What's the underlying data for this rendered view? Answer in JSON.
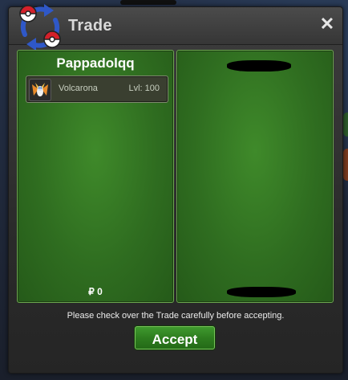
{
  "window": {
    "title": "Trade",
    "close_label": "✕",
    "notice": "Please check over the Trade carefully before accepting.",
    "accept_label": "Accept"
  },
  "left_panel": {
    "player_name": "Pappadolqq",
    "offer": [
      {
        "pokemon": "Volcarona",
        "level": "Lvl: 100",
        "icon": "volcarona-icon"
      }
    ],
    "money": "₽ 0"
  },
  "right_panel": {
    "player_name": "",
    "offer": [],
    "money": ""
  },
  "colors": {
    "panel_green": "#2f6d20",
    "panel_border": "#6ba64e",
    "accept_button": "#2e7d1f",
    "window_frame": "#333333"
  },
  "icons": {
    "logo": "pokeball-trade-arrows-icon",
    "close": "close-icon"
  }
}
